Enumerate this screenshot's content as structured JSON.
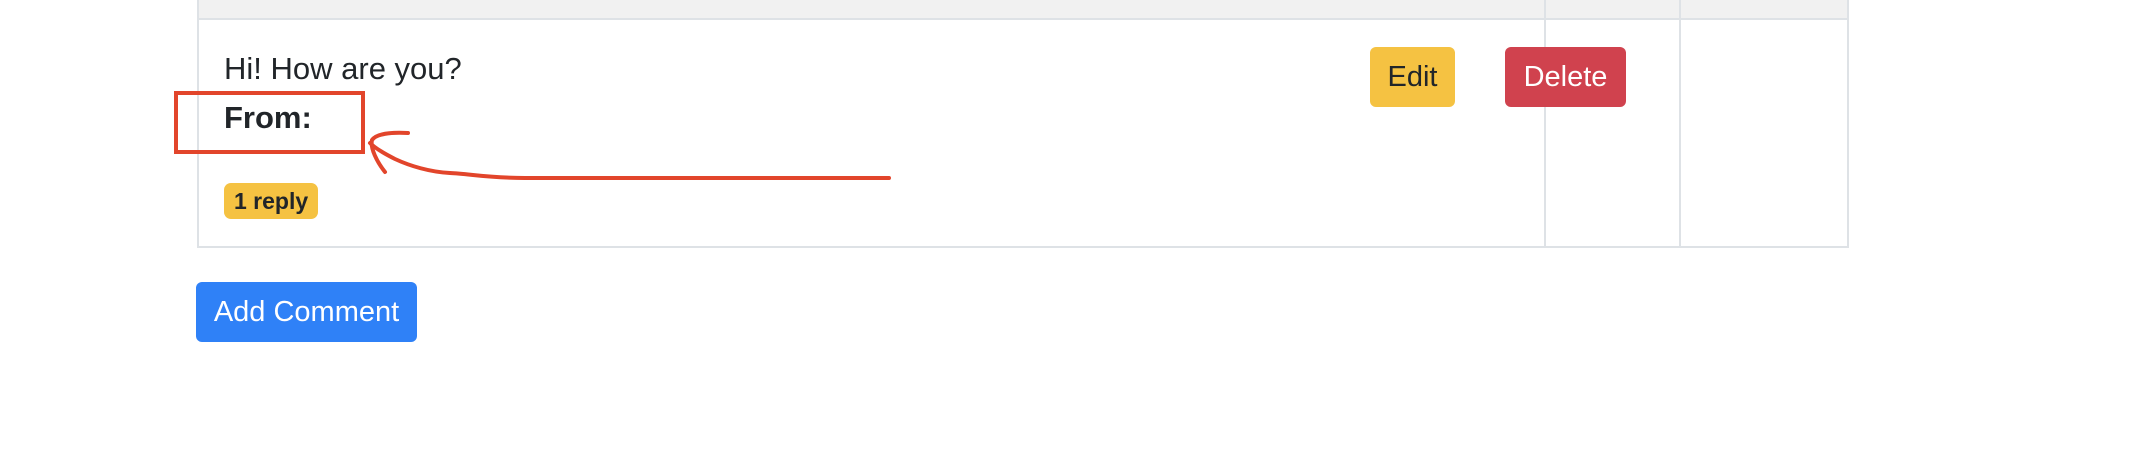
{
  "comment": {
    "text": "Hi! How are you?",
    "from_label": "From:",
    "reply_badge": "1 reply"
  },
  "actions": {
    "edit_label": "Edit",
    "delete_label": "Delete"
  },
  "footer": {
    "add_comment_label": "Add Comment"
  },
  "colors": {
    "edit": "#f5c242",
    "delete": "#d0424e",
    "add": "#2f81f7",
    "annotation": "#e2452b"
  },
  "icons": {
    "annotation_box": "annotation-rectangle",
    "annotation_arrow": "annotation-arrow"
  }
}
